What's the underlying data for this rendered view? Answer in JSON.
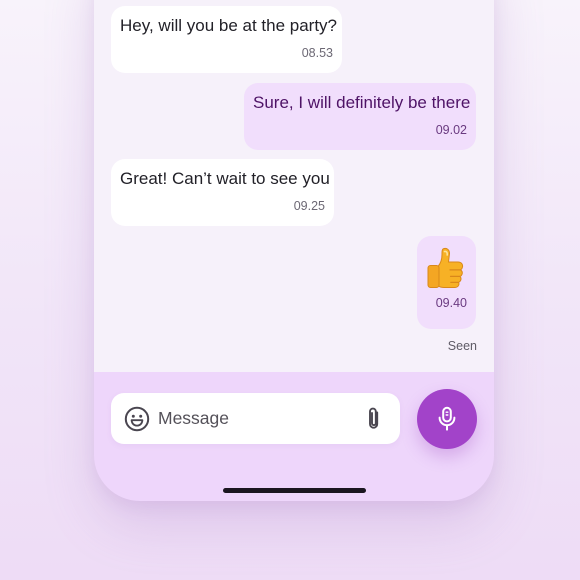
{
  "messages": [
    {
      "direction": "incoming",
      "text": "Hey, will you be at the party?",
      "time": "08.53"
    },
    {
      "direction": "outgoing",
      "text": "Sure, I will definitely be there",
      "time": "09.02"
    },
    {
      "direction": "incoming",
      "text": "Great! Can’t wait to see you",
      "time": "09.25"
    },
    {
      "direction": "outgoing",
      "emoji": "thumbs-up-emoji",
      "time": "09.40"
    }
  ],
  "status": {
    "read_receipt": "Seen"
  },
  "composer": {
    "placeholder": "Message",
    "value": "",
    "emoji_icon": "smiley-icon",
    "attach_icon": "paperclip-icon",
    "send_icon": "microphone-icon"
  },
  "colors": {
    "accent": "#a243c9",
    "outgoing_bubble": "#f1defc",
    "incoming_bubble": "#ffffff",
    "chat_background": "#f6f1fa",
    "composer_background": "#eed6fb"
  }
}
